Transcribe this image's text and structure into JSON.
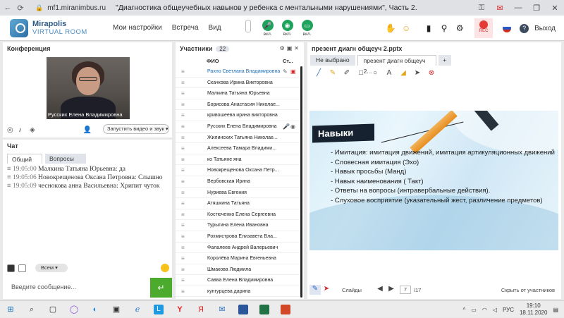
{
  "browser": {
    "url": "mf1.miranimbus.ru",
    "title": "\"Диагностика общеучебных навыков у ребенка с ментальными нарушениями\", Часть 2."
  },
  "header": {
    "logo_line1": "Mirapolis",
    "logo_line2": "VIRTUAL ROOM",
    "menu": [
      "Мои настройки",
      "Встреча",
      "Вид"
    ],
    "devices": [
      {
        "icon": "microphone-icon",
        "label": "вкл."
      },
      {
        "icon": "camera-icon",
        "label": "вкл."
      },
      {
        "icon": "screen-share-icon",
        "label": "вкл."
      }
    ],
    "rec_label": "REC",
    "exit_label": "Выход"
  },
  "conference": {
    "title": "Конференция",
    "video_name": "Русских Елена Владимировна",
    "start_video_label": "Запустить видео и звук"
  },
  "chat": {
    "title": "Чат",
    "tabs": [
      "Общий",
      "Вопросы"
    ],
    "messages": [
      {
        "time": "19:05:00",
        "author": "Малкина Татьяна Юрьевна:",
        "text": "да"
      },
      {
        "time": "19:05:06",
        "author": "Новокрещенова Оксана Петровна:",
        "text": "Слышно"
      },
      {
        "time": "19:05:09",
        "author": "чеснокова анна Васильевна:",
        "text": "Хрипит чуток"
      }
    ],
    "recipient": "Всем",
    "input_placeholder": "Введите сообщение..."
  },
  "participants": {
    "title": "Участники",
    "count": "22",
    "col_name": "ФИО",
    "col_status": "Ст...",
    "list": [
      "Рахно Светлана Владимировна",
      "Скачкова Ирина Викторовна",
      "Малкина Татьяна Юрьевна",
      "Борисова Анастасия Николае...",
      "кривошеева ирина викторовна",
      "Русских Елена Владимировна",
      "Жилинских Татьяна Николае...",
      "Алексеева Тамара Владими...",
      "ко Татьяне яна",
      "Новокрещенова Оксана Петр...",
      "Вербовская Ирина",
      "Нуриева Евгения",
      "Атяшкина Татьяна",
      "Костюченко Елена Сергеевна",
      "Турыгина Елена Ивановна",
      "Рохмистрова Елизавета Вла...",
      "Фалалеев Андрей Валерьевич",
      "Королёва Марина Евгеньевна",
      "Шмакова Людмила",
      "Савва Елена Владимировна",
      "кунгурцева дарина"
    ]
  },
  "presentation": {
    "title": "презент диагн общеуч 2.pptx",
    "tabs": [
      "Не выбрано",
      "презент диагн общеуч 2..."
    ],
    "add_tab": "+",
    "slide_title": "Навыки",
    "bullets": [
      "- Имитация: имитация движений, имитация артикуляционных движений",
      "- Словесная имитация (Эхо)",
      "- Навык просьбы (Манд)",
      "- Навык наименования ( Такт)",
      "- Ответы на вопросы (интравербальные действия).",
      "- Слуховое восприятие (указательный жест, различение предметов)"
    ],
    "slides_label": "Слайды",
    "current_page": "7",
    "total_pages": "/17",
    "hide_label": "Скрыть от участников"
  },
  "taskbar": {
    "lang": "РУС",
    "time": "19:10",
    "date": "18.11.2020"
  }
}
